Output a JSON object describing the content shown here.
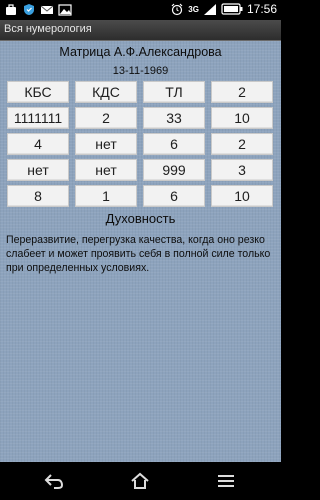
{
  "status_bar": {
    "time": "17:56",
    "network": "3G",
    "icons": [
      "bag-icon",
      "shield-icon",
      "mail-icon",
      "image-icon",
      "alarm-icon",
      "signal-icon",
      "battery-icon"
    ]
  },
  "title_bar": {
    "title": "Вся нумерология"
  },
  "matrix": {
    "title": "Матрица А.Ф.Александрова",
    "date": "13-11-1969",
    "rows": [
      [
        "КБС",
        "КДС",
        "ТЛ",
        "2"
      ],
      [
        "1111111",
        "2",
        "33",
        "10"
      ],
      [
        "4",
        "нет",
        "6",
        "2"
      ],
      [
        "нет",
        "нет",
        "999",
        "3"
      ],
      [
        "8",
        "1",
        "6",
        "10"
      ]
    ]
  },
  "section": {
    "title": "Духовность",
    "description": "Переразвитие, перегрузка качества, когда оно резко слабеет и может проявить себя в полной силе только при определенных условиях."
  },
  "nav_bar": {
    "buttons": [
      "back-icon",
      "home-icon",
      "menu-icon"
    ]
  },
  "colors": {
    "background": "#8da3bd",
    "cell": "#f2f2f2",
    "titlebar": "#3a3a3a"
  }
}
